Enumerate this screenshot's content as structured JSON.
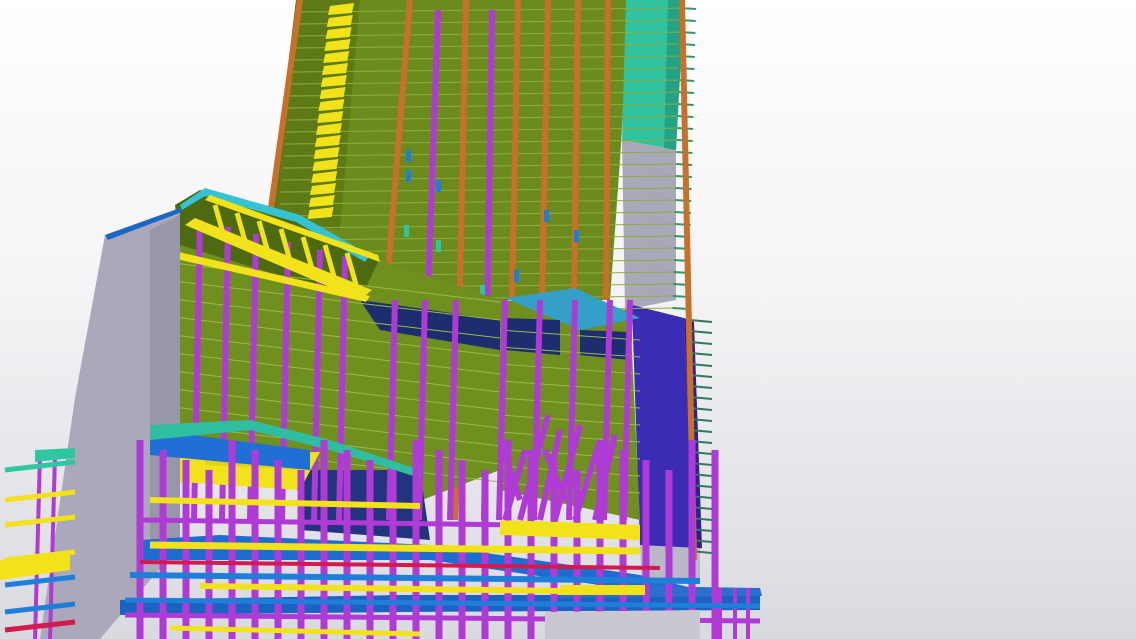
{
  "scene": {
    "subject": "structural-bim-model",
    "colors": {
      "slab": "#6f8f1f",
      "slab_dark": "#5a7716",
      "column_magenta": "#b03ad6",
      "column_orange": "#c8702a",
      "beam_yellow": "#f2e21a",
      "core_grey": "#a9a8b8",
      "core_teal": "#2fc7a0",
      "wall_blue": "#3a2cb4",
      "beam_blue": "#1f7fd8",
      "beam_red": "#d21a4e",
      "cyan_edge": "#34c3d2"
    }
  }
}
